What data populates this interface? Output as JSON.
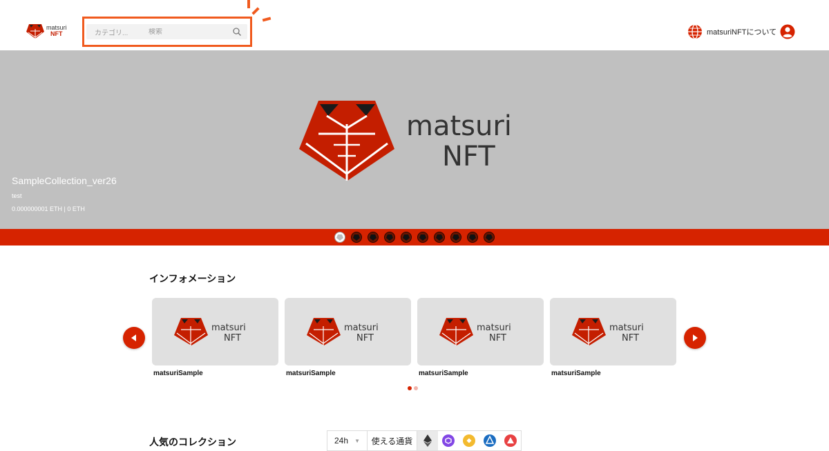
{
  "header": {
    "logo": {
      "word": "matsuri",
      "sub": "NFT"
    },
    "search": {
      "category_label": "カテゴリ...",
      "placeholder": "検索"
    },
    "about_link": "matsuriNFTについて"
  },
  "hero": {
    "logo": {
      "word": "matsuri",
      "sub": "NFT"
    },
    "title": "SampleCollection_ver26",
    "subtitle": "test",
    "price": "0.000000001 ETH | 0 ETH",
    "slide_count": 10,
    "active_slide": 0
  },
  "information": {
    "title": "インフォメーション",
    "cards": [
      {
        "label": "matsuriSample"
      },
      {
        "label": "matsuriSample"
      },
      {
        "label": "matsuriSample"
      },
      {
        "label": "matsuriSample"
      }
    ],
    "pages": 2,
    "active_page": 0
  },
  "popular": {
    "title": "人気のコレクション",
    "period": "24h",
    "currency_label": "使える通貨",
    "coins": [
      "ethereum-icon",
      "polygon-icon",
      "bnb-icon",
      "astar-icon",
      "avalanche-icon"
    ]
  },
  "colors": {
    "brand_red": "#d62300",
    "highlight_orange": "#f05a1e",
    "hero_bg": "#c0c0c0"
  }
}
